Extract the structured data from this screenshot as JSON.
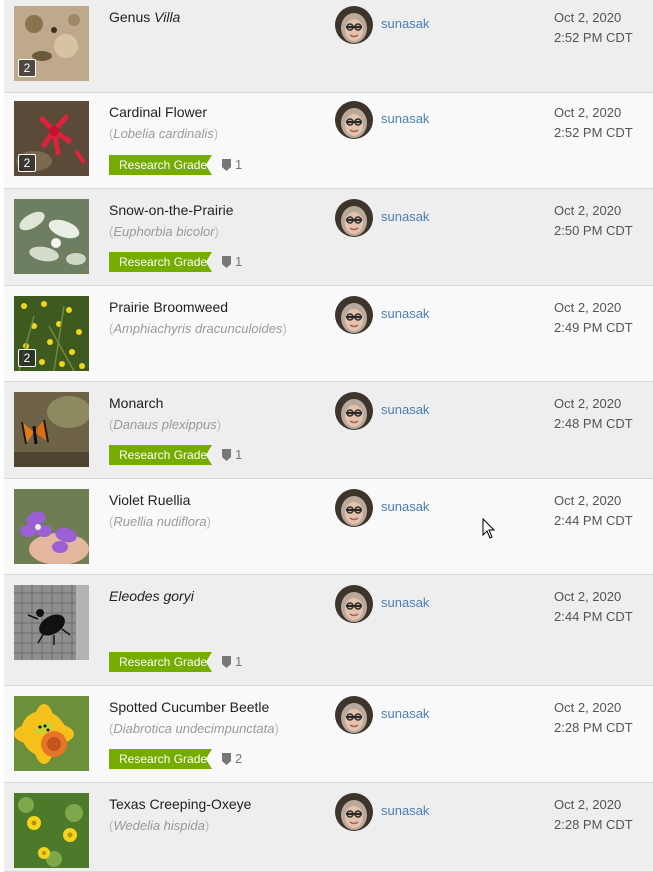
{
  "observations": [
    {
      "common_name": "Genus",
      "common_name_italic": "Villa",
      "scientific_name": "",
      "photo_count": "2",
      "quality": "",
      "id_count": "",
      "user": "sunasak",
      "date": "Oct 2, 2020",
      "time": "2:52 PM CDT",
      "thumb": "dirt-leaves"
    },
    {
      "common_name": "Cardinal Flower",
      "scientific_name": "Lobelia cardinalis",
      "photo_count": "2",
      "quality": "Research Grade",
      "id_count": "1",
      "user": "sunasak",
      "date": "Oct 2, 2020",
      "time": "2:52 PM CDT",
      "thumb": "red-flower"
    },
    {
      "common_name": "Snow-on-the-Prairie",
      "scientific_name": "Euphorbia bicolor",
      "photo_count": "",
      "quality": "Research Grade",
      "id_count": "1",
      "user": "sunasak",
      "date": "Oct 2, 2020",
      "time": "2:50 PM CDT",
      "thumb": "white-leaves"
    },
    {
      "common_name": "Prairie Broomweed",
      "scientific_name": "Amphiachyris dracunculoides",
      "photo_count": "2",
      "quality": "",
      "id_count": "",
      "user": "sunasak",
      "date": "Oct 2, 2020",
      "time": "2:49 PM CDT",
      "thumb": "yellow-weeds"
    },
    {
      "common_name": "Monarch",
      "scientific_name": "Danaus plexippus",
      "photo_count": "",
      "quality": "Research Grade",
      "id_count": "1",
      "user": "sunasak",
      "date": "Oct 2, 2020",
      "time": "2:48 PM CDT",
      "thumb": "butterfly"
    },
    {
      "common_name": "Violet Ruellia",
      "scientific_name": "Ruellia nudiflora",
      "photo_count": "",
      "quality": "",
      "id_count": "",
      "user": "sunasak",
      "date": "Oct 2, 2020",
      "time": "2:44 PM CDT",
      "thumb": "purple-flower"
    },
    {
      "common_name": "Eleodes goryi",
      "scientific_name": "",
      "photo_count": "",
      "quality": "Research Grade",
      "id_count": "1",
      "user": "sunasak",
      "date": "Oct 2, 2020",
      "time": "2:44 PM CDT",
      "thumb": "beetle-screen"
    },
    {
      "common_name": "Spotted Cucumber Beetle",
      "scientific_name": "Diabrotica undecimpunctata",
      "photo_count": "",
      "quality": "Research Grade",
      "id_count": "2",
      "user": "sunasak",
      "date": "Oct 2, 2020",
      "time": "2:28 PM CDT",
      "thumb": "yellow-flower-beetle"
    },
    {
      "common_name": "Texas Creeping-Oxeye",
      "scientific_name": "Wedelia hispida",
      "photo_count": "",
      "quality": "",
      "id_count": "",
      "user": "sunasak",
      "date": "Oct 2, 2020",
      "time": "2:28 PM CDT",
      "thumb": "yellow-daisies"
    }
  ],
  "colors": {
    "research_grade": "#74ac00",
    "user_link": "#4a7fb5"
  }
}
